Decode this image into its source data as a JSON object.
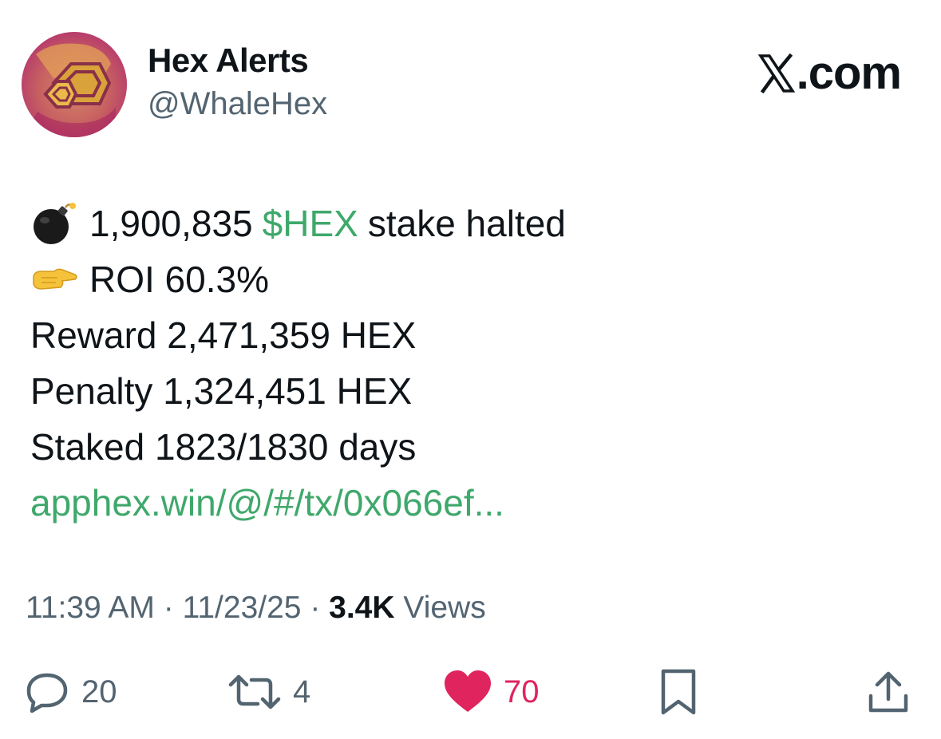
{
  "tweet": {
    "author": {
      "display_name": "Hex Alerts",
      "handle": "@WhaleHex",
      "avatar_icon": "hex-logo-avatar"
    },
    "site_logo": {
      "text": ".com",
      "icon": "x-logo-icon"
    },
    "lines": {
      "l1_emoji": "bomb-icon",
      "l1_amount": "1,900,835",
      "l1_cashtag": "$HEX",
      "l1_rest": "stake halted",
      "l2_emoji": "pointing-hand-icon",
      "l2_text": "ROI 60.3%",
      "l3_text": "Reward 2,471,359 HEX",
      "l4_text": "Penalty 1,324,451 HEX",
      "l5_text": "Staked 1823/1830 days",
      "link": "apphex.win/@/#/tx/0x066ef..."
    },
    "meta": {
      "time": "11:39 AM",
      "sep1": " · ",
      "date": "11/23/25",
      "sep2": " · ",
      "views_count": "3.4K",
      "views_label": " Views"
    },
    "actions": {
      "reply_count": "20",
      "repost_count": "4",
      "like_count": "70"
    },
    "colors": {
      "link_green": "#3fa86b",
      "like_pink": "#e0245e",
      "muted": "#536471"
    }
  }
}
